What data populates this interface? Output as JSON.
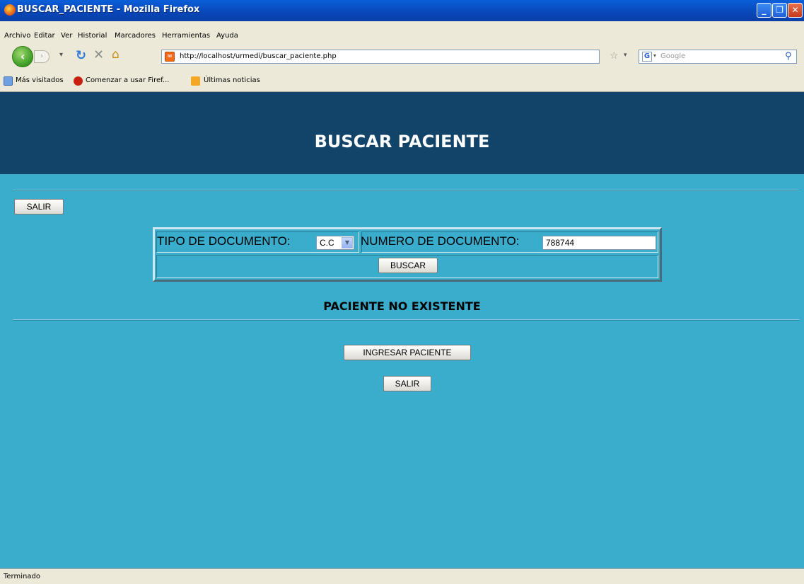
{
  "window": {
    "title": "BUSCAR_PACIENTE - Mozilla Firefox",
    "minimize": "_",
    "maximize": "❐",
    "close": "✕"
  },
  "menu": [
    "Archivo",
    "Editar",
    "Ver",
    "Historial",
    "Marcadores",
    "Herramientas",
    "Ayuda"
  ],
  "nav": {
    "url": "http://localhost/urmedi/buscar_paciente.php",
    "search_placeholder": "Google"
  },
  "bookmarks": [
    "Más visitados",
    "Comenzar a usar Firef...",
    "Últimas noticias"
  ],
  "page": {
    "heading": "BUSCAR PACIENTE",
    "salir_top": "SALIR",
    "tipo_label": "TIPO DE DOCUMENTO:",
    "tipo_value": "C.C",
    "numero_label": "NUMERO DE DOCUMENTO:",
    "numero_value": "788744",
    "buscar": "BUSCAR",
    "message": "PACIENTE NO EXISTENTE",
    "ingresar": "INGRESAR PACIENTE",
    "salir_bottom": "SALIR"
  },
  "status": "Terminado",
  "colors": {
    "page_bg": "#3aaccc",
    "header_bg": "#124469"
  }
}
